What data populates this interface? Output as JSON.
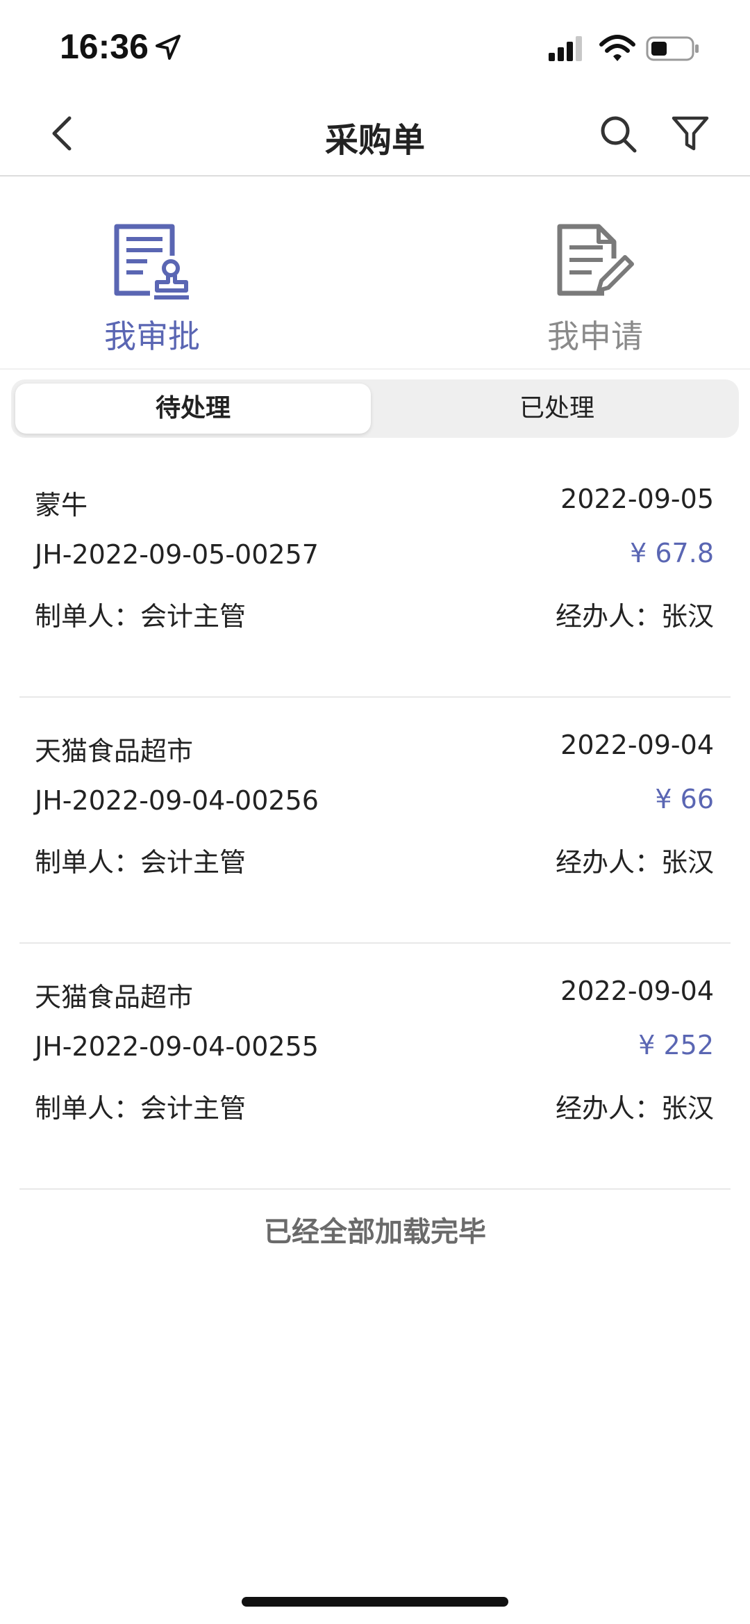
{
  "status_bar": {
    "time": "16:36"
  },
  "nav": {
    "title": "采购单"
  },
  "roles": [
    {
      "label": "我审批",
      "icon": "approval-stamp-icon",
      "active": true
    },
    {
      "label": "我申请",
      "icon": "document-edit-icon",
      "active": false
    }
  ],
  "tabs": [
    {
      "label": "待处理",
      "active": true
    },
    {
      "label": "已处理",
      "active": false
    }
  ],
  "orders": [
    {
      "vendor": "蒙牛",
      "date": "2022-09-05",
      "code": "JH-2022-09-05-00257",
      "amount": "¥ 67.8",
      "creator": "制单人：会计主管",
      "handler": "经办人：张汉"
    },
    {
      "vendor": "天猫食品超市",
      "date": "2022-09-04",
      "code": "JH-2022-09-04-00256",
      "amount": "¥ 66",
      "creator": "制单人：会计主管",
      "handler": "经办人：张汉"
    },
    {
      "vendor": "天猫食品超市",
      "date": "2022-09-04",
      "code": "JH-2022-09-04-00255",
      "amount": "¥ 252",
      "creator": "制单人：会计主管",
      "handler": "经办人：张汉"
    }
  ],
  "footer": {
    "load_end": "已经全部加载完毕"
  },
  "colors": {
    "accent": "#5a66b3",
    "inactive": "#8a8a8a"
  }
}
